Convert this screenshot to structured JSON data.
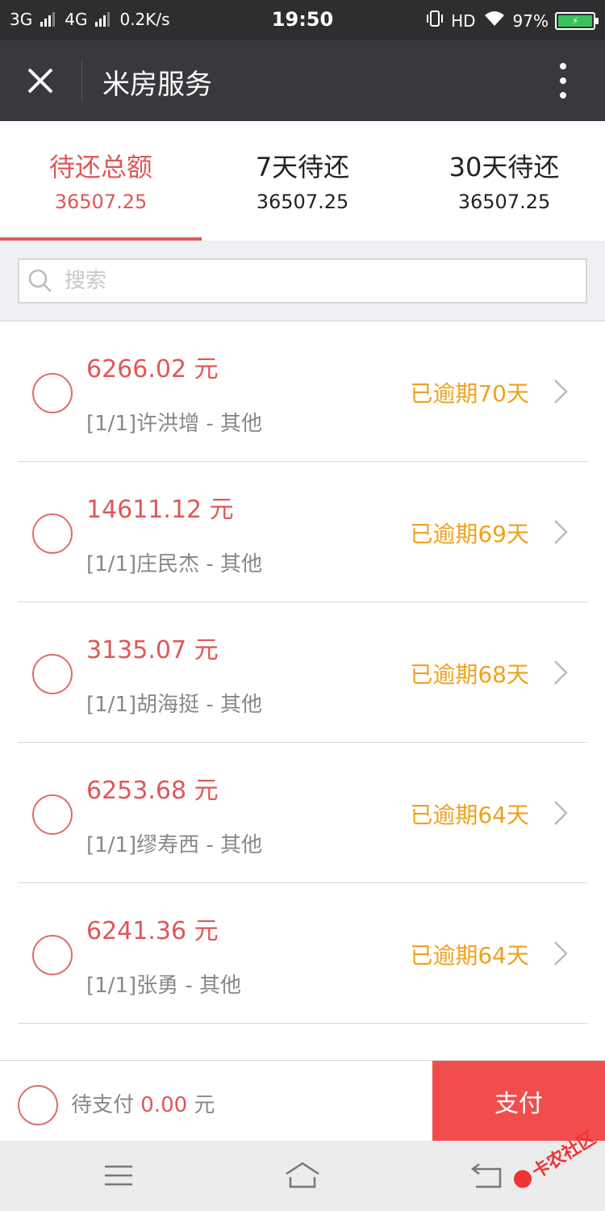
{
  "status_bar": {
    "network1": "3G",
    "network2": "4G",
    "speed": "0.2K/s",
    "time": "19:50",
    "hd": "HD",
    "battery": "97%"
  },
  "title_bar": {
    "title": "米房服务",
    "close_icon": "close-icon",
    "more_icon": "more-vertical-icon"
  },
  "tabs": [
    {
      "label": "待还总额",
      "value": "36507.25",
      "active": true
    },
    {
      "label": "7天待还",
      "value": "36507.25",
      "active": false
    },
    {
      "label": "30天待还",
      "value": "36507.25",
      "active": false
    }
  ],
  "search": {
    "placeholder": "搜索"
  },
  "items": [
    {
      "amount": "6266.02 元",
      "desc": "[1/1]许洪增 - 其他",
      "status": "已逾期70天"
    },
    {
      "amount": "14611.12 元",
      "desc": "[1/1]庄民杰 - 其他",
      "status": "已逾期69天"
    },
    {
      "amount": "3135.07 元",
      "desc": "[1/1]胡海挺 - 其他",
      "status": "已逾期68天"
    },
    {
      "amount": "6253.68 元",
      "desc": "[1/1]缪寿西 - 其他",
      "status": "已逾期64天"
    },
    {
      "amount": "6241.36 元",
      "desc": "[1/1]张勇 - 其他",
      "status": "已逾期64天"
    }
  ],
  "pay_bar": {
    "pending_label": "待支付",
    "pending_amount": "0.00",
    "unit": "元",
    "pay_button": "支付"
  },
  "watermark": "卡农社区",
  "colors": {
    "accent_red": "#e05757",
    "pay_button": "#f24d4d",
    "overdue_orange": "#f0a11b",
    "title_bar": "#39393d"
  }
}
